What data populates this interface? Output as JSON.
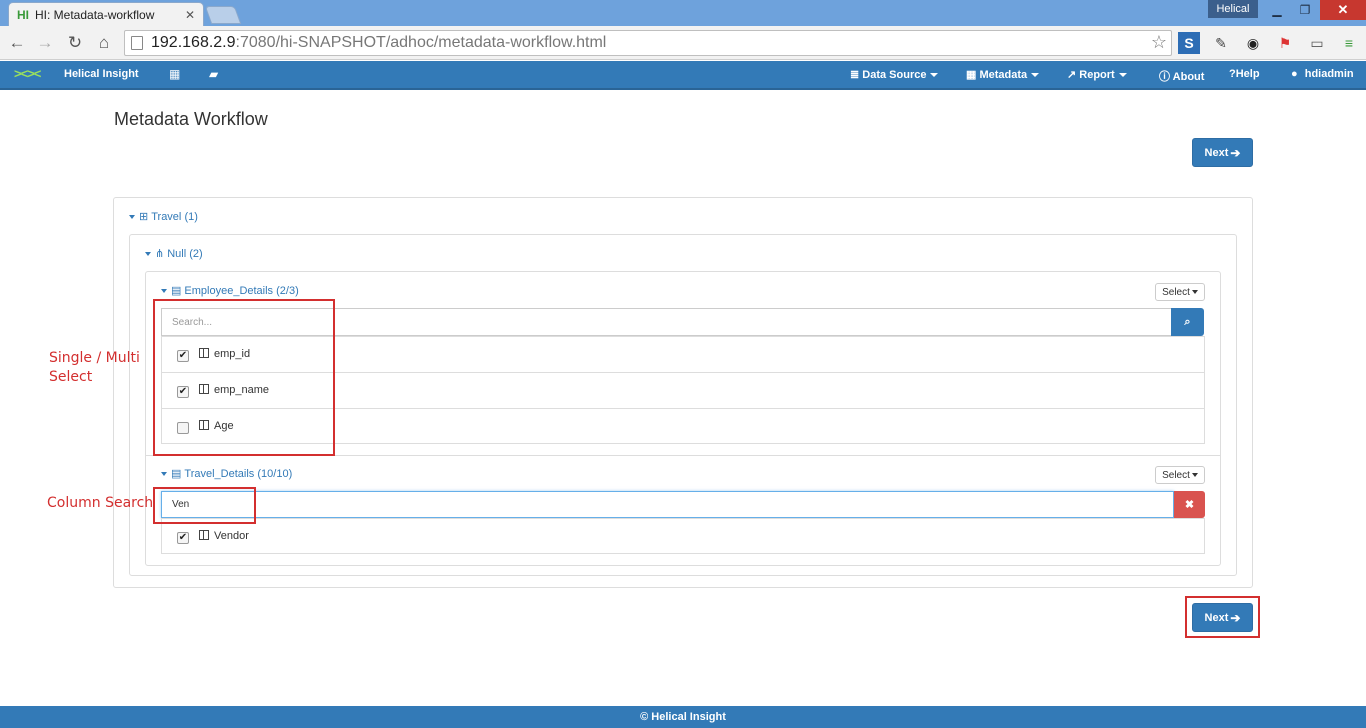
{
  "browser": {
    "tab_title": "HI: Metadata-workflow",
    "tab_favicon": "HI",
    "profile_badge": "Helical",
    "url_host": "192.168.2.9",
    "url_rest": ":7080/hi-SNAPSHOT/adhoc/metadata-workflow.html"
  },
  "navbar": {
    "brand": "Helical Insight",
    "data_source": "Data Source",
    "metadata": "Metadata",
    "report": "Report",
    "about": "About",
    "help": "Help",
    "user": "hdiadmin",
    "icons": [
      "dashboard-grid-icon",
      "folder-icon",
      "database-icon",
      "table-icon",
      "line-chart-icon",
      "info-icon",
      "question-icon",
      "user-icon"
    ]
  },
  "page": {
    "title": "Metadata Workflow",
    "next_label": "Next"
  },
  "tree": {
    "root_label": "Travel",
    "root_count": "(1)",
    "schema_label": "Null",
    "schema_count": "(2)",
    "tables": [
      {
        "name": "Employee_Details",
        "count": "(2/3)",
        "select_label": "Select",
        "search_placeholder": "Search...",
        "columns": [
          {
            "name": "emp_id",
            "checked": true
          },
          {
            "name": "emp_name",
            "checked": true
          },
          {
            "name": "Age",
            "checked": false
          }
        ]
      },
      {
        "name": "Travel_Details",
        "count": "(10/10)",
        "select_label": "Select",
        "search_value": "Ven",
        "columns": [
          {
            "name": "Vendor",
            "checked": true
          }
        ]
      }
    ]
  },
  "annotations": {
    "select_note": "Single / Multi Select",
    "search_note": "Column Search",
    "color": "#d32f2f"
  },
  "footer": {
    "text": "© Helical Insight"
  },
  "colors": {
    "primary": "#337ab7",
    "danger": "#d9534f",
    "titlebar": "#6ea2dc"
  }
}
